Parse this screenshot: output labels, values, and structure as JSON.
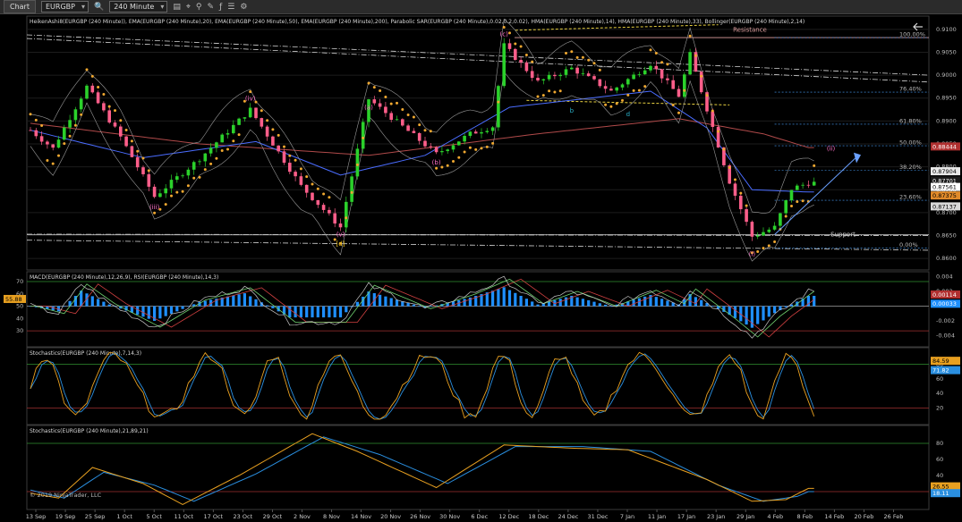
{
  "toolbar": {
    "tab": "Chart",
    "instrument": "EURGBP",
    "interval": "240 Minute"
  },
  "colors": {
    "background": "#000000",
    "up_bar": "#2bd12b",
    "down_bar": "#ff5e8a",
    "sar": "#f0a830",
    "ema20": "#ff9a9a",
    "ema50": "#4a6cff",
    "ema200": "#b04a4a",
    "macd_hist": "#1e8fff",
    "stoch_k": "#e8a020",
    "stoch_d": "#2a8fe0",
    "fib": "#4aa3ff",
    "resistance": "#e0a0a0"
  },
  "chart_data": [
    {
      "type": "candlestick",
      "title": "HeikenAshi8(EURGBP (240 Minute)), EMA(EURGBP (240 Minute),20), EMA(EURGBP (240 Minute),50), EMA(EURGBP (240 Minute),200), Parabolic SAR(EURGBP (240 Minute),0.02,0.2,0.02), HMA(EURGBP (240 Minute),14), HMA(EURGBP (240 Minute),33), Bollinger(EURGBP (240 Minute),2,14)",
      "x_ticks": [
        "13 Sep",
        "19 Sep",
        "25 Sep",
        "1 Oct",
        "5 Oct",
        "11 Oct",
        "17 Oct",
        "23 Oct",
        "29 Oct",
        "2 Nov",
        "8 Nov",
        "14 Nov",
        "20 Nov",
        "26 Nov",
        "30 Nov",
        "6 Dec",
        "12 Dec",
        "18 Dec",
        "24 Dec",
        "31 Dec",
        "7 Jan",
        "11 Jan",
        "17 Jan",
        "23 Jan",
        "29 Jan",
        "4 Feb",
        "8 Feb",
        "14 Feb",
        "20 Feb",
        "26 Feb"
      ],
      "y_ticks": [
        0.86,
        0.865,
        0.87,
        0.875,
        0.88,
        0.885,
        0.89,
        0.895,
        0.9,
        0.905,
        0.91
      ],
      "y_tick_labels": [
        "0.8600",
        "0.8650",
        "0.8700",
        "0.8750",
        "0.8800",
        "0.8850",
        "0.8900",
        "0.8950",
        "0.9000",
        "0.9050",
        "0.9100"
      ],
      "ylim": [
        0.8575,
        0.9125
      ],
      "price_path": [
        [
          0,
          0.888
        ],
        [
          4,
          0.884
        ],
        [
          10,
          0.8975
        ],
        [
          16,
          0.8865
        ],
        [
          22,
          0.8735
        ],
        [
          30,
          0.8818
        ],
        [
          39,
          0.8925
        ],
        [
          48,
          0.8758
        ],
        [
          55,
          0.8668
        ],
        [
          60,
          0.8948
        ],
        [
          72,
          0.8828
        ],
        [
          78,
          0.8872
        ],
        [
          82,
          0.8888
        ],
        [
          84,
          0.9065
        ],
        [
          90,
          0.8985
        ],
        [
          96,
          0.9015
        ],
        [
          103,
          0.8965
        ],
        [
          110,
          0.9025
        ],
        [
          115,
          0.8955
        ],
        [
          117,
          0.9045
        ],
        [
          124,
          0.8768
        ],
        [
          128,
          0.8648
        ],
        [
          132,
          0.8668
        ],
        [
          135,
          0.8752
        ],
        [
          138,
          0.8765
        ]
      ],
      "ema200_path": [
        [
          0,
          0.8895
        ],
        [
          30,
          0.885
        ],
        [
          60,
          0.8825
        ],
        [
          90,
          0.8872
        ],
        [
          115,
          0.8905
        ],
        [
          130,
          0.8872
        ],
        [
          138,
          0.8842
        ]
      ],
      "ema50_path": [
        [
          0,
          0.888
        ],
        [
          20,
          0.882
        ],
        [
          40,
          0.8855
        ],
        [
          55,
          0.8782
        ],
        [
          70,
          0.8825
        ],
        [
          85,
          0.893
        ],
        [
          110,
          0.8965
        ],
        [
          120,
          0.8885
        ],
        [
          128,
          0.875
        ],
        [
          138,
          0.8745
        ]
      ],
      "price_labels": [
        {
          "value": 0.88444,
          "text": "0.88444",
          "bg": "#b03030",
          "fg": "#ffffff"
        },
        {
          "value": 0.87904,
          "text": "0.87904",
          "bg": "#e8e8e8",
          "fg": "#000000"
        },
        {
          "value": 0.87701,
          "text": "0.87701",
          "bg": "#1a1a1a",
          "fg": "#ffffff"
        },
        {
          "value": 0.87561,
          "text": "0.87561",
          "bg": "#ffffff",
          "fg": "#000000"
        },
        {
          "value": 0.87375,
          "text": "0.87375",
          "bg": "#e08a2a",
          "fg": "#000000"
        },
        {
          "value": 0.87137,
          "text": "0.87137",
          "bg": "#d8d8d8",
          "fg": "#000000"
        }
      ],
      "fib_levels": [
        {
          "value": 0.9082,
          "text": "100.00%"
        },
        {
          "value": 0.8963,
          "text": "76.40%"
        },
        {
          "value": 0.8893,
          "text": "61.80%"
        },
        {
          "value": 0.8846,
          "text": "50.00%"
        },
        {
          "value": 0.8792,
          "text": "38.20%"
        },
        {
          "value": 0.8727,
          "text": "23.60%"
        },
        {
          "value": 0.8623,
          "text": "0.00%"
        }
      ],
      "annotations": [
        {
          "text": "Resistance",
          "x": 133,
          "y": 0.9095,
          "color": "#e0a0a0"
        },
        {
          "text": "Support",
          "x": 133,
          "y": 0.8648,
          "color": "#c8c8c8"
        },
        {
          "text": "(iii)",
          "x": 22,
          "y": 0.8708,
          "color": "#ff6fc8"
        },
        {
          "text": "(iv)",
          "x": 39,
          "y": 0.8945,
          "color": "#ff6fc8"
        },
        {
          "text": "(v)",
          "x": 55,
          "y": 0.8648,
          "color": "#ff6fc8"
        },
        {
          "text": "[d]",
          "x": 55,
          "y": 0.8628,
          "color": "#e8c020"
        },
        {
          "text": "(a)",
          "x": 60,
          "y": 0.8925,
          "color": "#ff6fc8"
        },
        {
          "text": "(b)",
          "x": 72,
          "y": 0.8805,
          "color": "#ff6fc8"
        },
        {
          "text": "(c)",
          "x": 84,
          "y": 0.9085,
          "color": "#ff6fc8"
        },
        {
          "text": "b",
          "x": 96,
          "y": 0.8918,
          "color": "#2ab0c8"
        },
        {
          "text": "d",
          "x": 106,
          "y": 0.891,
          "color": "#2ab0c8"
        },
        {
          "text": "(i)",
          "x": 128,
          "y": 0.8605,
          "color": "#ff6fc8"
        },
        {
          "text": "(ii)",
          "x": 142,
          "y": 0.8835,
          "color": "#ff6fc8"
        }
      ]
    },
    {
      "type": "line",
      "title": "MACD(EURGBP (240 Minute),12,26,9), RSI(EURGBP (240 Minute),14,3)",
      "y_ticks_left": [
        30,
        40,
        50,
        60,
        70
      ],
      "y_ticks_right": [
        "0.004",
        "0.002",
        "-0.002",
        "-0.004"
      ],
      "levels": [
        70,
        50,
        30
      ],
      "ylim": [
        17,
        78
      ],
      "rsi_path": [
        [
          0,
          50
        ],
        [
          5,
          44
        ],
        [
          9,
          68
        ],
        [
          14,
          52
        ],
        [
          22,
          33
        ],
        [
          30,
          55
        ],
        [
          38,
          65
        ],
        [
          46,
          37
        ],
        [
          55,
          37
        ],
        [
          60,
          67
        ],
        [
          70,
          48
        ],
        [
          78,
          60
        ],
        [
          84,
          72
        ],
        [
          90,
          52
        ],
        [
          96,
          62
        ],
        [
          103,
          50
        ],
        [
          110,
          63
        ],
        [
          115,
          52
        ],
        [
          117,
          64
        ],
        [
          124,
          40
        ],
        [
          128,
          25
        ],
        [
          132,
          42
        ],
        [
          138,
          62
        ]
      ],
      "left_marker": {
        "value": 55.88,
        "text": "55.88"
      },
      "right_labels": [
        {
          "value": 59.5,
          "text": "0.00114",
          "bg": "#b03030",
          "fg": "#ffffff"
        },
        {
          "value": 52,
          "text": "0.00033",
          "bg": "#1e8fff",
          "fg": "#ffffff"
        }
      ]
    },
    {
      "type": "line",
      "title": "Stochastics(EURGBP (240 Minute),7,14,3)",
      "y_ticks": [
        20,
        40,
        60,
        80
      ],
      "levels": [
        80,
        20
      ],
      "ylim": [
        0,
        100
      ],
      "right_labels": [
        {
          "value": 84.59,
          "text": "84.59",
          "bg": "#e8a020",
          "fg": "#000000"
        },
        {
          "value": 71.82,
          "text": "71.82",
          "bg": "#2a8fe0",
          "fg": "#ffffff"
        }
      ]
    },
    {
      "type": "line",
      "title": "Stochastics(EURGBP (240 Minute),21,89,21)",
      "y_ticks": [
        20,
        40,
        60,
        80
      ],
      "levels": [
        80,
        20
      ],
      "ylim": [
        0,
        100
      ],
      "k_path": [
        [
          0,
          18
        ],
        [
          5,
          12
        ],
        [
          11,
          50
        ],
        [
          20,
          30
        ],
        [
          27,
          4
        ],
        [
          37,
          40
        ],
        [
          50,
          92
        ],
        [
          58,
          70
        ],
        [
          72,
          25
        ],
        [
          84,
          78
        ],
        [
          96,
          74
        ],
        [
          106,
          72
        ],
        [
          120,
          35
        ],
        [
          128,
          8
        ],
        [
          134,
          10
        ],
        [
          138,
          24
        ]
      ],
      "d_path": [
        [
          0,
          22
        ],
        [
          6,
          12
        ],
        [
          13,
          44
        ],
        [
          22,
          28
        ],
        [
          29,
          8
        ],
        [
          40,
          42
        ],
        [
          52,
          88
        ],
        [
          62,
          66
        ],
        [
          74,
          30
        ],
        [
          86,
          76
        ],
        [
          98,
          76
        ],
        [
          110,
          70
        ],
        [
          122,
          28
        ],
        [
          130,
          8
        ],
        [
          136,
          14
        ],
        [
          138,
          20
        ]
      ],
      "right_labels": [
        {
          "value": 26.55,
          "text": "26.55",
          "bg": "#e8a020",
          "fg": "#000000"
        },
        {
          "value": 18.11,
          "text": "18.11",
          "bg": "#2a8fe0",
          "fg": "#ffffff"
        }
      ]
    }
  ],
  "copyright": "© 2019 NinjaTrader, LLC"
}
